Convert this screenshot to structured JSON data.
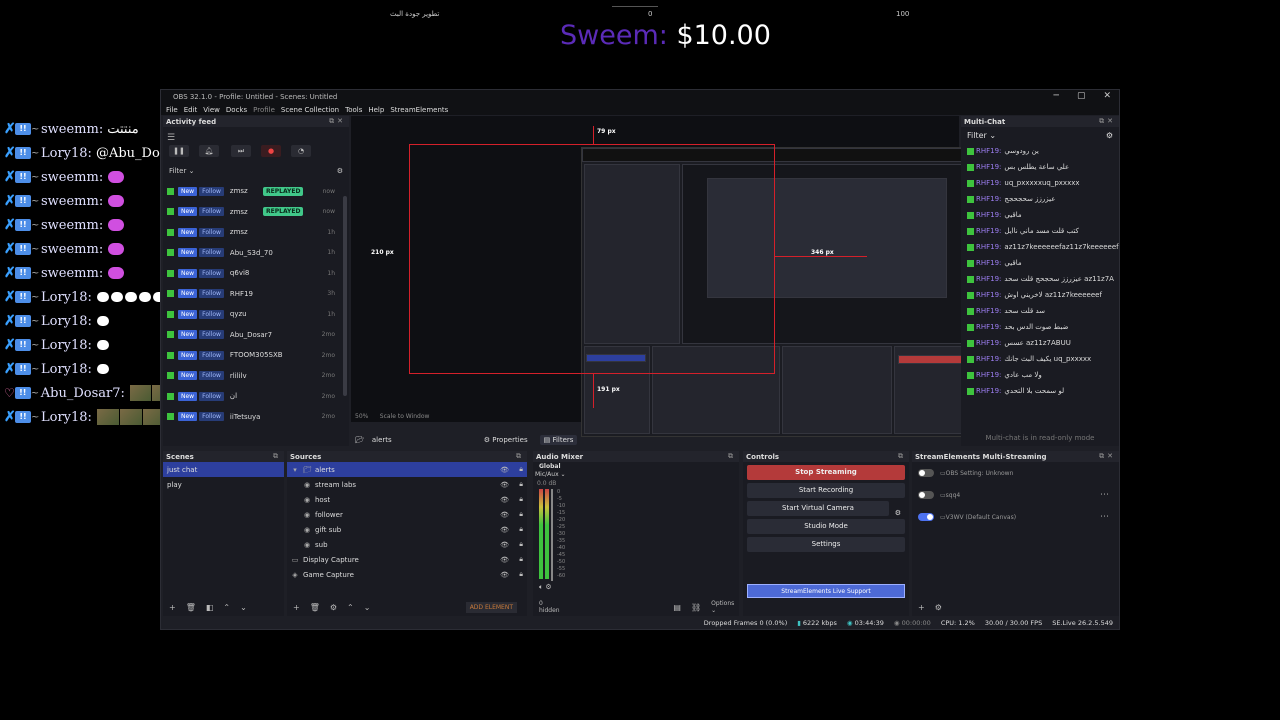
{
  "overlay": {
    "goal": {
      "left_label": "تطوير جودة البث",
      "min": "0",
      "max": "100"
    },
    "tip": {
      "user": "Sweem:",
      "amount": "$10.00"
    },
    "chat": [
      {
        "name": "sweemm:",
        "msg": "منتتت",
        "emote": ""
      },
      {
        "name": "Lory18:",
        "msg": "@Abu_Dosar7 منتتت",
        "emote": ""
      },
      {
        "name": "sweemm:",
        "msg": "",
        "emote": "pink"
      },
      {
        "name": "sweemm:",
        "msg": "",
        "emote": "pink"
      },
      {
        "name": "sweemm:",
        "msg": "",
        "emote": "pink"
      },
      {
        "name": "sweemm:",
        "msg": "",
        "emote": "pink"
      },
      {
        "name": "sweemm:",
        "msg": "",
        "emote": "pink"
      },
      {
        "name": "Lory18:",
        "msg": "",
        "emote": "clouds"
      },
      {
        "name": "Lory18:",
        "msg": "",
        "emote": "cloud"
      },
      {
        "name": "Lory18:",
        "msg": "",
        "emote": "cloud"
      },
      {
        "name": "Lory18:",
        "msg": "",
        "emote": "cloud"
      },
      {
        "name": "Abu_Dosar7:",
        "msg": "",
        "emote": "images"
      },
      {
        "name": "Lory18:",
        "msg": "",
        "emote": "images"
      }
    ]
  },
  "obs": {
    "title": "OBS 32.1.0 - Profile: Untitled - Scenes: Untitled",
    "menu": [
      "File",
      "Edit",
      "View",
      "Docks",
      "Profile",
      "Scene Collection",
      "Tools",
      "Help",
      "StreamElements"
    ],
    "activity": {
      "title": "Activity feed",
      "filter": "Filter",
      "rows": [
        {
          "user": "zmsz",
          "replayed": "REPLAYED",
          "time": "now"
        },
        {
          "user": "zmsz",
          "replayed": "REPLAYED",
          "time": "now"
        },
        {
          "user": "zmsz",
          "replayed": "",
          "time": "1h"
        },
        {
          "user": "Abu_S3d_70",
          "replayed": "",
          "time": "1h"
        },
        {
          "user": "q6vi8",
          "replayed": "",
          "time": "1h"
        },
        {
          "user": "RHF19",
          "replayed": "",
          "time": "3h"
        },
        {
          "user": "qyzu",
          "replayed": "",
          "time": "1h"
        },
        {
          "user": "Abu_Dosar7",
          "replayed": "",
          "time": "2mo"
        },
        {
          "user": "FTOOM305SXB",
          "replayed": "",
          "time": "2mo"
        },
        {
          "user": "rlililv",
          "replayed": "",
          "time": "2mo"
        },
        {
          "user": "ان",
          "replayed": "",
          "time": "2mo"
        },
        {
          "user": "iiTetsuya",
          "replayed": "",
          "time": "2mo"
        }
      ],
      "new_label": "New",
      "follow_label": "Follow"
    },
    "preview": {
      "dim_top": "79 px",
      "dim_left": "210 px",
      "dim_right": "346 px",
      "dim_bottom": "191 px",
      "zoom": "50%",
      "scale": "Scale to Window"
    },
    "source_toolbar": {
      "source": "alerts",
      "properties": "Properties",
      "filters": "Filters"
    },
    "multichat": {
      "title": "Multi-Chat",
      "filter": "Filter",
      "lines": [
        {
          "name": "RHF19:",
          "msg": "ين رودوسي"
        },
        {
          "name": "RHF19:",
          "msg": "علي ساعة يطلس بس"
        },
        {
          "name": "RHF19:",
          "msg": "uq_pxxxxxuq_pxxxxx"
        },
        {
          "name": "RHF19:",
          "msg": "عيزرزز سحجحجج"
        },
        {
          "name": "RHF19:",
          "msg": "ماقيي"
        },
        {
          "name": "RHF19:",
          "msg": "كتب قلت مسد ماني ناايل"
        },
        {
          "name": "RHF19:",
          "msg": "az11z7keeeeeefaz11z7keeeeeef"
        },
        {
          "name": "RHF19:",
          "msg": "ماقيي"
        },
        {
          "name": "RHF19:",
          "msg": "عيزرزز سحجحج قلت سحد az11z7A"
        },
        {
          "name": "RHF19:",
          "msg": "لاخريني اوش az11z7keeeeeef"
        },
        {
          "name": "RHF19:",
          "msg": "سد قلت سحد"
        },
        {
          "name": "RHF19:",
          "msg": "ضبط صوت الدس بحد"
        },
        {
          "name": "RHF19:",
          "msg": "عسس az11z7ABUU"
        },
        {
          "name": "RHF19:",
          "msg": "يكيف البث جانك uq_pxxxxx"
        },
        {
          "name": "RHF19:",
          "msg": "ولا مب عادي"
        },
        {
          "name": "RHF19:",
          "msg": "لو سمحت بلا التحدي"
        }
      ],
      "readonly": "Multi-chat is in read-only mode"
    },
    "scenes": {
      "title": "Scenes",
      "items": [
        "just chat",
        "play"
      ]
    },
    "sources": {
      "title": "Sources",
      "items": [
        {
          "label": "alerts",
          "indent": 0,
          "icon": "folder"
        },
        {
          "label": "stream labs",
          "indent": 1,
          "icon": "browser"
        },
        {
          "label": "host",
          "indent": 1,
          "icon": "browser"
        },
        {
          "label": "follower",
          "indent": 1,
          "icon": "browser"
        },
        {
          "label": "gift sub",
          "indent": 1,
          "icon": "browser"
        },
        {
          "label": "sub",
          "indent": 1,
          "icon": "browser"
        },
        {
          "label": "Display Capture",
          "indent": 0,
          "icon": "monitor"
        },
        {
          "label": "Game Capture",
          "indent": 0,
          "icon": "gamepad"
        }
      ],
      "add_element": "ADD ELEMENT"
    },
    "mixer": {
      "title": "Audio Mixer",
      "tab": "Global",
      "channel": "Mic/Aux",
      "level": "0.0 dB",
      "hidden": "0 hidden",
      "options": "Options",
      "ticks": [
        "0",
        "-5",
        "-10",
        "-15",
        "-20",
        "-25",
        "-30",
        "-35",
        "-40",
        "-45",
        "-50",
        "-55",
        "-60"
      ]
    },
    "controls": {
      "title": "Controls",
      "stop_streaming": "Stop Streaming",
      "start_recording": "Start Recording",
      "start_virtual_camera": "Start Virtual Camera",
      "studio_mode": "Studio Mode",
      "settings": "Settings",
      "se_support": "StreamElements Live Support"
    },
    "se_multi": {
      "title": "StreamElements Multi-Streaming",
      "rows": [
        {
          "label": "OBS Setting: Unknown",
          "on": false
        },
        {
          "label": "sqq4",
          "on": false
        },
        {
          "label": "V3WV (Default Canvas)",
          "on": true
        }
      ]
    },
    "status": {
      "dropped": "Dropped Frames 0 (0.0%)",
      "bitrate": "6222 kbps",
      "live_time": "03:44:39",
      "rec_time": "00:00:00",
      "cpu": "CPU: 1.2%",
      "fps": "30.00 / 30.00 FPS",
      "version": "SE.Live 26.2.5.549"
    }
  },
  "colors": {
    "accent_blue": "#2d3f9e",
    "stop_red": "#b43a3a",
    "guide_red": "#d4202a",
    "replayed_green": "#41c88a",
    "tip_purple": "#5b2bb8"
  }
}
